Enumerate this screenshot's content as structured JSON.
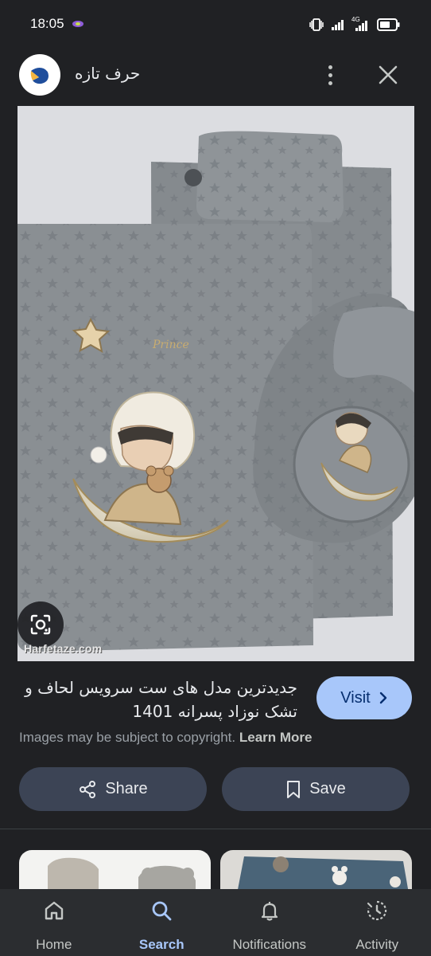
{
  "status_bar": {
    "time": "18:05",
    "network_label": "4G"
  },
  "header": {
    "site_name": "حرف تازه",
    "logo_icon": "harfetaze-logo-icon",
    "more_icon": "more-vertical-icon",
    "close_icon": "close-icon"
  },
  "image": {
    "watermark": "Harfetaze.com",
    "description_icon": "lens-icon"
  },
  "result": {
    "title": "جدیدترین مدل های ست سرویس لحاف و تشک نوزاد پسرانه 1401",
    "visit_label": "Visit",
    "copyright_text": "Images may be subject to copyright.",
    "learn_more_label": "Learn More"
  },
  "actions": {
    "share_label": "Share",
    "save_label": "Save"
  },
  "bottom_nav": {
    "items": [
      {
        "label": "Home",
        "icon": "home-icon",
        "active": false
      },
      {
        "label": "Search",
        "icon": "search-icon",
        "active": true
      },
      {
        "label": "Notifications",
        "icon": "bell-icon",
        "active": false
      },
      {
        "label": "Activity",
        "icon": "activity-icon",
        "active": false
      }
    ]
  },
  "colors": {
    "background": "#202124",
    "visit_button": "#a8c7fa",
    "action_button": "#3c4455",
    "active_nav": "#a8c7fa"
  }
}
